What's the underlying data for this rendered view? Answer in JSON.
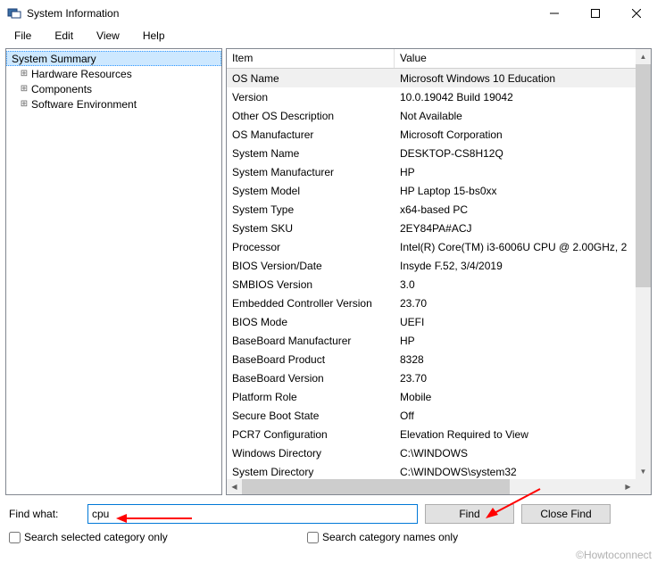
{
  "titlebar": {
    "title": "System Information"
  },
  "menubar": {
    "file": "File",
    "edit": "Edit",
    "view": "View",
    "help": "Help"
  },
  "tree": {
    "root": "System Summary",
    "items": [
      "Hardware Resources",
      "Components",
      "Software Environment"
    ]
  },
  "list": {
    "headers": {
      "item": "Item",
      "value": "Value"
    },
    "rows": [
      {
        "item": "OS Name",
        "value": "Microsoft Windows 10 Education",
        "sel": true
      },
      {
        "item": "Version",
        "value": "10.0.19042 Build 19042"
      },
      {
        "item": "Other OS Description",
        "value": "Not Available"
      },
      {
        "item": "OS Manufacturer",
        "value": "Microsoft Corporation"
      },
      {
        "item": "System Name",
        "value": "DESKTOP-CS8H12Q"
      },
      {
        "item": "System Manufacturer",
        "value": "HP"
      },
      {
        "item": "System Model",
        "value": "HP Laptop 15-bs0xx"
      },
      {
        "item": "System Type",
        "value": "x64-based PC"
      },
      {
        "item": "System SKU",
        "value": "2EY84PA#ACJ"
      },
      {
        "item": "Processor",
        "value": "Intel(R) Core(TM) i3-6006U CPU @ 2.00GHz, 2"
      },
      {
        "item": "BIOS Version/Date",
        "value": "Insyde F.52, 3/4/2019"
      },
      {
        "item": "SMBIOS Version",
        "value": "3.0"
      },
      {
        "item": "Embedded Controller Version",
        "value": "23.70"
      },
      {
        "item": "BIOS Mode",
        "value": "UEFI"
      },
      {
        "item": "BaseBoard Manufacturer",
        "value": "HP"
      },
      {
        "item": "BaseBoard Product",
        "value": "8328"
      },
      {
        "item": "BaseBoard Version",
        "value": "23.70"
      },
      {
        "item": "Platform Role",
        "value": "Mobile"
      },
      {
        "item": "Secure Boot State",
        "value": "Off"
      },
      {
        "item": "PCR7 Configuration",
        "value": "Elevation Required to View"
      },
      {
        "item": "Windows Directory",
        "value": "C:\\WINDOWS"
      },
      {
        "item": "System Directory",
        "value": "C:\\WINDOWS\\system32"
      }
    ]
  },
  "find": {
    "label": "Find what:",
    "value": "cpu",
    "find_btn": "Find",
    "close_btn": "Close Find",
    "chk_selected": "Search selected category only",
    "chk_names": "Search category names only"
  },
  "watermark": "©Howtoconnect"
}
